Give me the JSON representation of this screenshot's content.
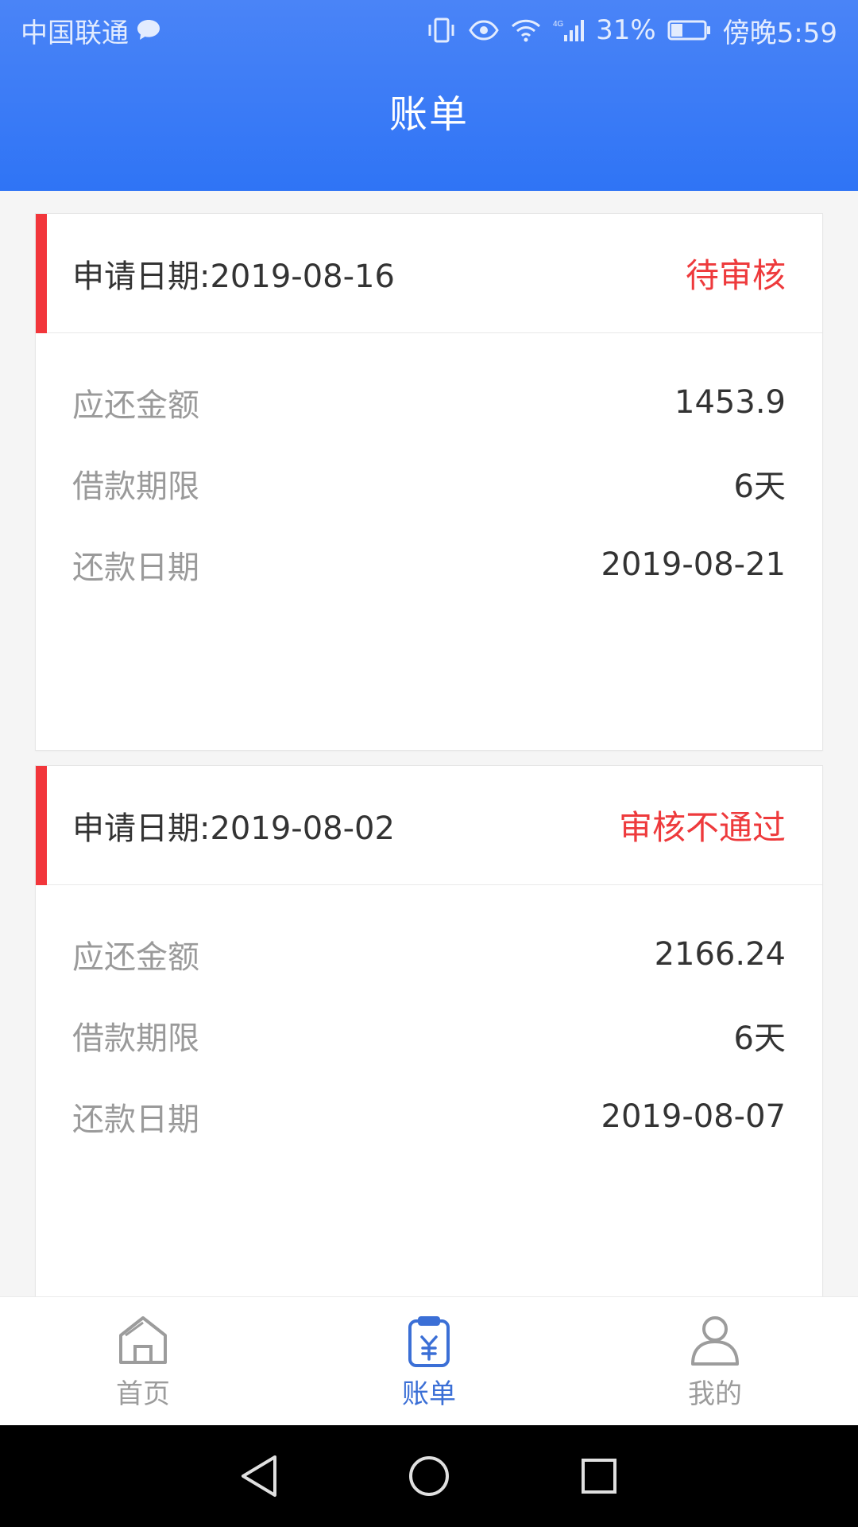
{
  "status_bar": {
    "carrier": "中国联通",
    "battery": "31%",
    "time": "傍晚5:59"
  },
  "header": {
    "title": "账单"
  },
  "bills": [
    {
      "apply_date": "申请日期:2019-08-16",
      "status": "待审核",
      "amount_label": "应还金额",
      "amount": "1453.9",
      "term_label": "借款期限",
      "term": "6天",
      "due_label": "还款日期",
      "due": "2019-08-21"
    },
    {
      "apply_date": "申请日期:2019-08-02",
      "status": "审核不通过",
      "amount_label": "应还金额",
      "amount": "2166.24",
      "term_label": "借款期限",
      "term": "6天",
      "due_label": "还款日期",
      "due": "2019-08-07"
    }
  ],
  "nav": {
    "home": "首页",
    "bills": "账单",
    "mine": "我的",
    "active": "bills"
  },
  "colors": {
    "header_blue": "#2f74f5",
    "accent_red": "#f2363b",
    "status_red": "#ee3a3c",
    "active_blue": "#3b6fd6"
  }
}
